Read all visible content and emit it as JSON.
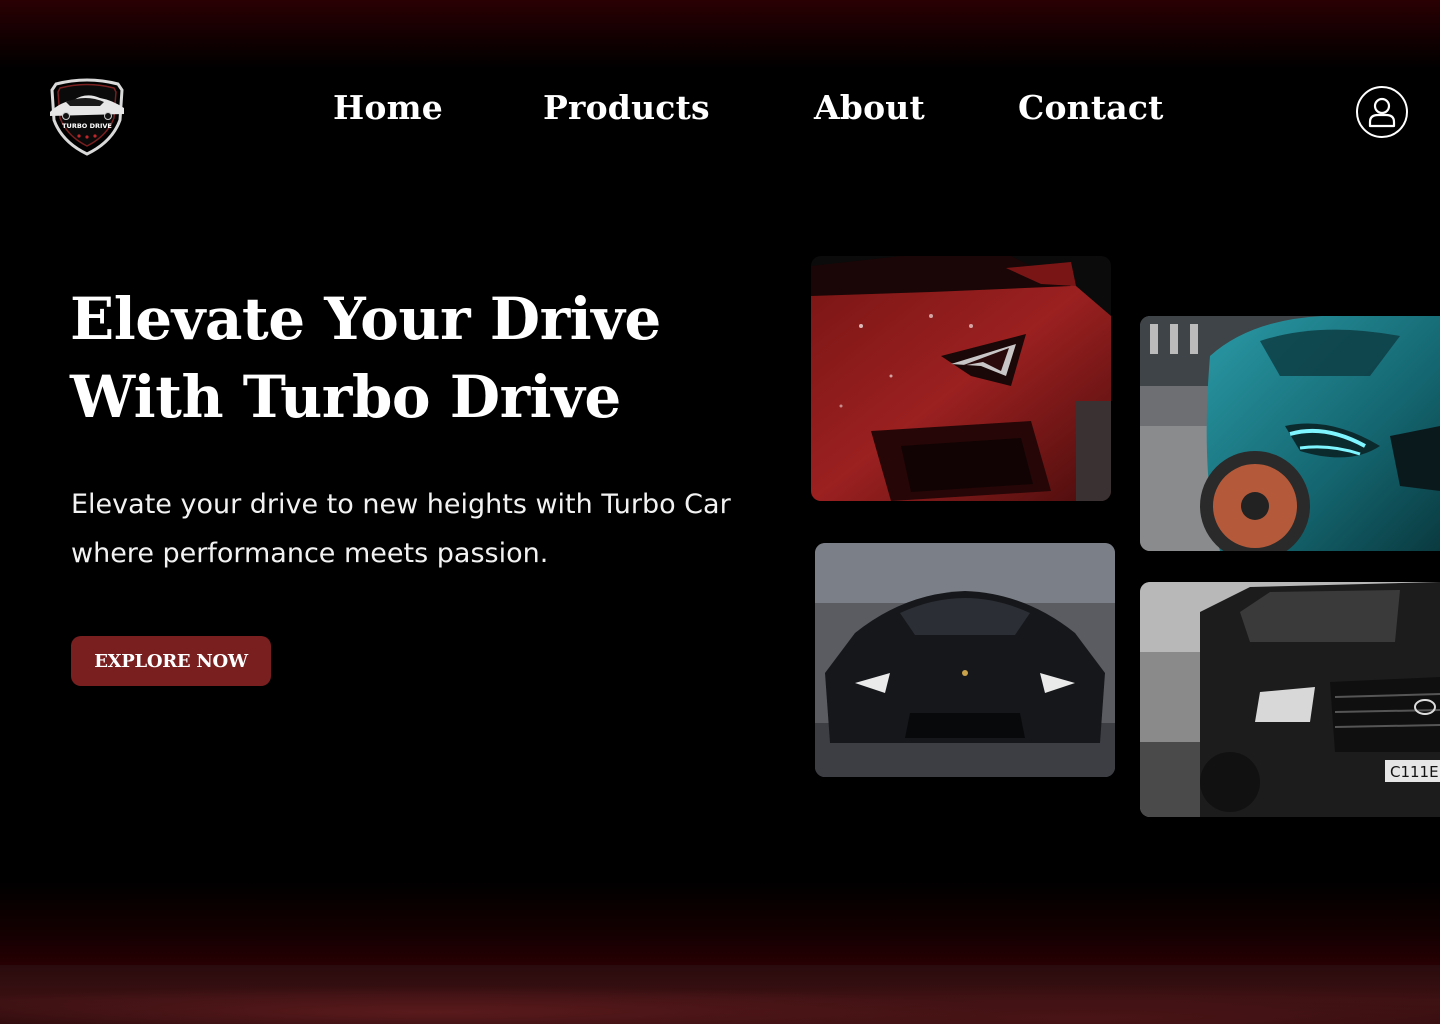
{
  "brand": {
    "logo_text": "TURBO DRIVE",
    "logo_icon": "car-shield-logo"
  },
  "nav": {
    "items": [
      {
        "label": "Home"
      },
      {
        "label": "Products"
      },
      {
        "label": "About"
      },
      {
        "label": "Contact"
      }
    ],
    "user_icon": "user-circle-icon"
  },
  "hero": {
    "title_line1": "Elevate Your Drive",
    "title_line2": "With Turbo Drive",
    "subtitle_line1": "Elevate your drive to new heights with Turbo Car",
    "subtitle_line2": "where performance meets passion.",
    "cta_label": "EXPLORE NOW"
  },
  "gallery": {
    "images": [
      {
        "subject": "red sports car front",
        "accent": "#8e1e1e"
      },
      {
        "subject": "teal sports car headlight",
        "accent": "#1f7f8a"
      },
      {
        "subject": "black supercar front",
        "accent": "#1b1d22"
      },
      {
        "subject": "black suv front",
        "accent": "#2a2a2a",
        "plate_text": "C111E"
      }
    ]
  },
  "colors": {
    "background": "#000000",
    "accent": "#7a1f20",
    "glow": "#2a0003",
    "text": "#ffffff"
  }
}
